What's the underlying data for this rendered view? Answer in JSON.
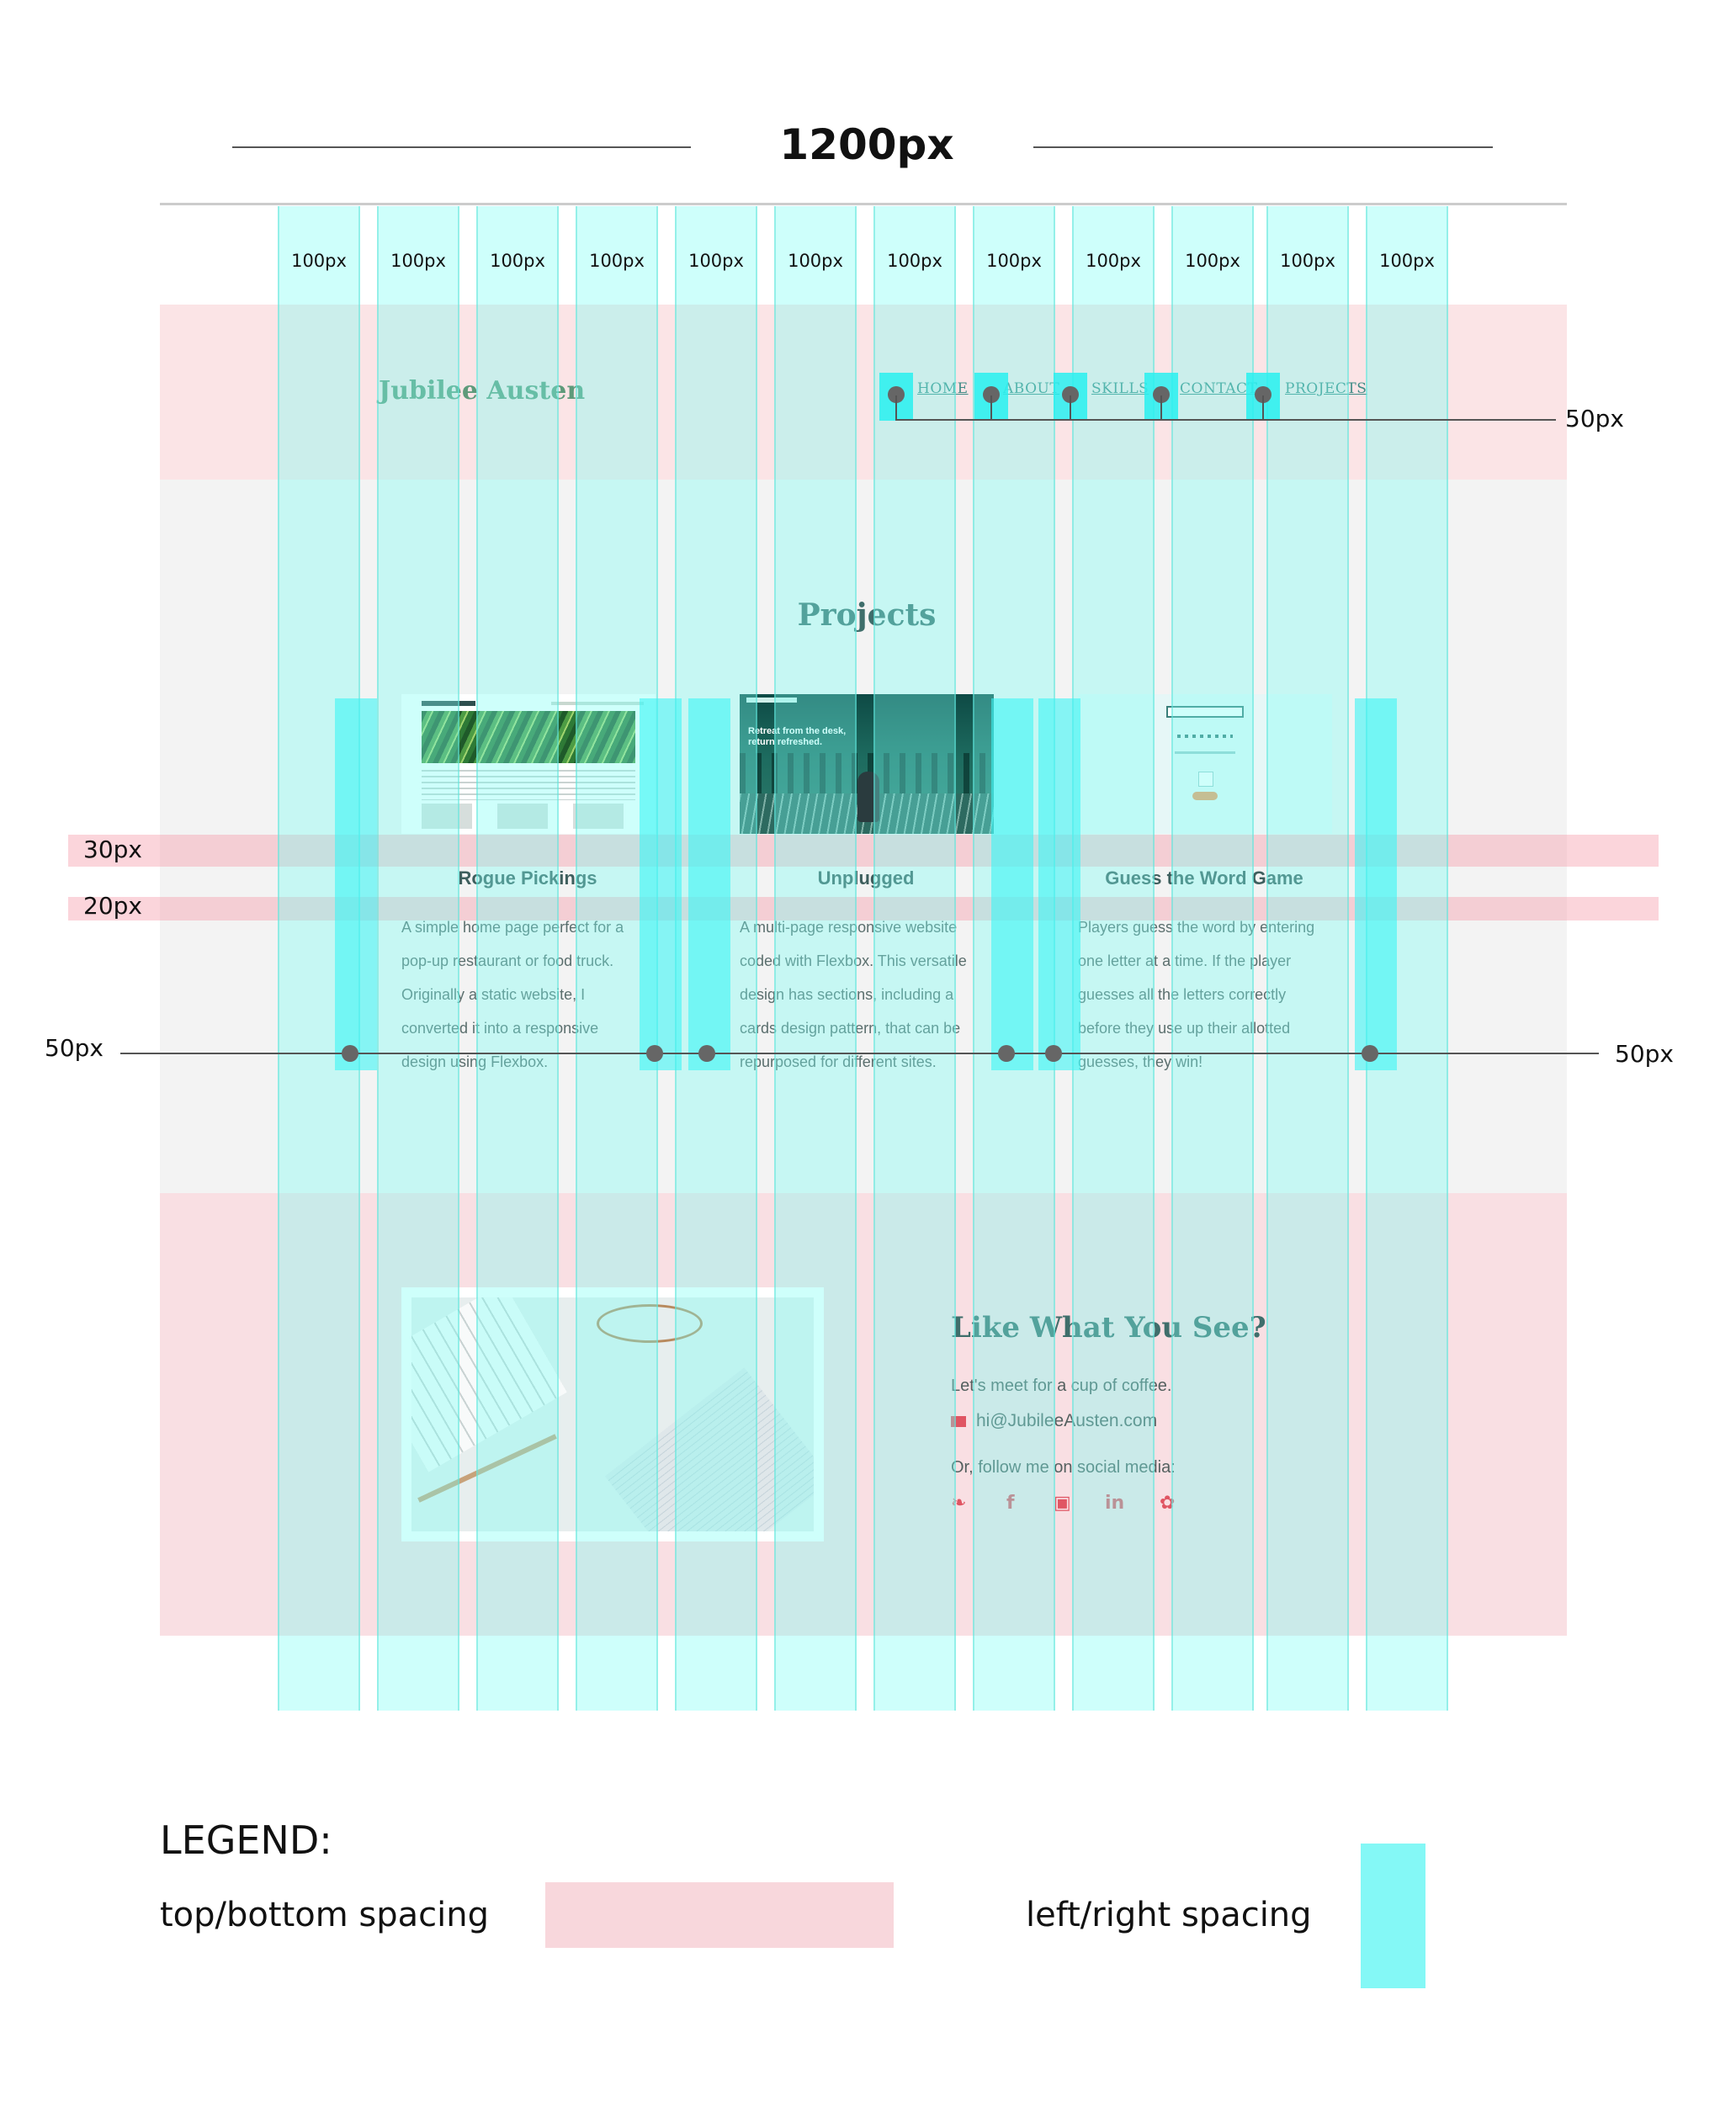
{
  "diagram": {
    "width_label": "1200px",
    "column_labels": [
      "100px",
      "100px",
      "100px",
      "100px",
      "100px",
      "100px",
      "100px",
      "100px",
      "100px",
      "100px",
      "100px",
      "100px"
    ],
    "nav_spacing_label": "50px",
    "row_spacing_labels": [
      "30px",
      "20px"
    ],
    "card_spacing_labels": [
      "50px",
      "50px"
    ]
  },
  "site": {
    "logo": "Jubilee Austen",
    "nav": [
      "HOME",
      "ABOUT",
      "SKILLS",
      "CONTACT",
      "PROJECTS"
    ],
    "projects_heading": "Projects",
    "cards": [
      {
        "title": "Rogue Pickings",
        "text": "A simple home page perfect for a pop-up restaurant or food truck. Originally a static website, I converted it into a responsive design using Flexbox."
      },
      {
        "title": "Unplugged",
        "text": "A multi-page responsive website coded with Flexbox. This versatile design has sections, including a cards design pattern, that can be repurposed for different sites."
      },
      {
        "title": "Guess the Word Game",
        "text": "Players guess the word by entering one letter at a time. If the player guesses all the letters correctly before they use up their allotted guesses, they win!"
      }
    ],
    "unplugged_hero_text": "Retreat from the desk, return refreshed.",
    "contact": {
      "heading": "Like What You See?",
      "line1": "Let's meet for a cup of coffee.",
      "email": "hi@JubileeAusten.com",
      "follow": "Or, follow me on social media:"
    },
    "social_icons": [
      "twitter-icon",
      "facebook-icon",
      "instagram-icon",
      "linkedin-icon",
      "github-icon"
    ],
    "accent_color": "#e05563",
    "heading_color": "#3f6e6b"
  },
  "legend": {
    "title": "LEGEND:",
    "top_bottom": "top/bottom spacing",
    "left_right": "left/right spacing",
    "top_bottom_color": "#f8d7dc",
    "left_right_color": "#84f8f6"
  }
}
